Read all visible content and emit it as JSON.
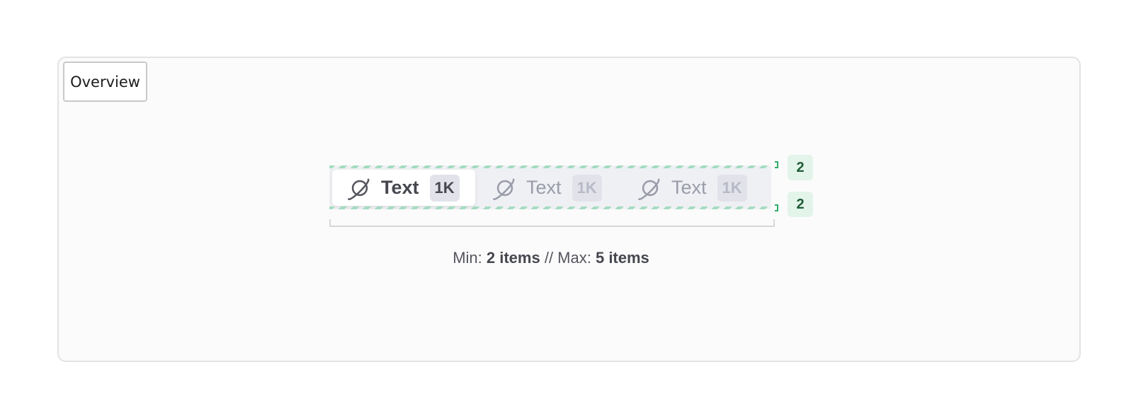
{
  "overview_tab": {
    "label": "Overview"
  },
  "tabs": [
    {
      "label": "Text",
      "badge": "1K",
      "state": "active",
      "icon": "planet-icon"
    },
    {
      "label": "Text",
      "badge": "1K",
      "state": "inactive",
      "icon": "planet-icon"
    },
    {
      "label": "Text",
      "badge": "1K",
      "state": "inactive",
      "icon": "planet-icon"
    }
  ],
  "spacing_badges": {
    "top": "2",
    "bottom": "2"
  },
  "caption": {
    "min_prefix": "Min: ",
    "min_value": "2 items",
    "separator": " // Max: ",
    "max_value": "5 items"
  },
  "colors": {
    "accent_green": "#2fae65",
    "badge_green_bg": "#e3f4ea",
    "badge_green_text": "#1e5d36",
    "tabbar_bg": "#eff0f4"
  }
}
